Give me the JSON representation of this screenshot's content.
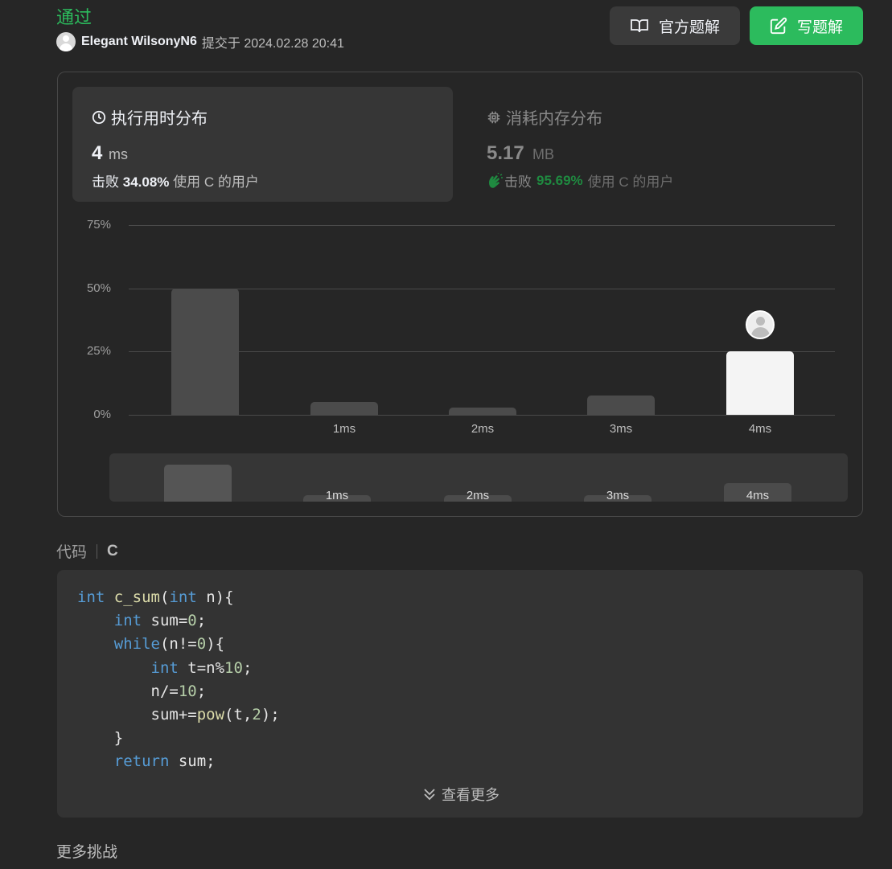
{
  "header": {
    "status": "通过",
    "username": "Elegant WilsonyN6",
    "submitted_label": "提交于 2024.02.28 20:41",
    "official_solution_label": "官方题解",
    "write_solution_label": "写题解"
  },
  "stats": {
    "runtime": {
      "title": "执行用时分布",
      "value": "4",
      "unit": "ms",
      "beat_label": "击败",
      "beat_pct": "34.08%",
      "beat_suffix": "使用 C 的用户"
    },
    "memory": {
      "title": "消耗内存分布",
      "value": "5.17",
      "unit": "MB",
      "beat_label": "击败",
      "beat_pct": "95.69%",
      "beat_suffix": "使用 C 的用户"
    }
  },
  "chart_data": {
    "type": "bar",
    "categories": [
      "",
      "1ms",
      "2ms",
      "3ms",
      "4ms"
    ],
    "values": [
      50,
      5,
      3,
      7.5,
      25
    ],
    "ylim": [
      0,
      75
    ],
    "yticks": [
      "0%",
      "25%",
      "50%",
      "75%"
    ],
    "highlight_index": 4,
    "grid": true,
    "colors": {
      "bar": "#4b4b4b",
      "highlight": "#f4f4f4",
      "grid": "#4a4a4a"
    },
    "minimap": {
      "categories": [
        "",
        "1ms",
        "2ms",
        "3ms",
        "4ms"
      ],
      "values": [
        50,
        5,
        3,
        7.5,
        25
      ]
    }
  },
  "code": {
    "label": "代码",
    "language": "C",
    "show_more_label": "查看更多"
  },
  "footer": {
    "more_challenges": "更多挑战"
  },
  "colors": {
    "accent": "#2cbb5d",
    "background": "#262626",
    "card": "#363636",
    "memory_beat": "#1f8a40"
  }
}
